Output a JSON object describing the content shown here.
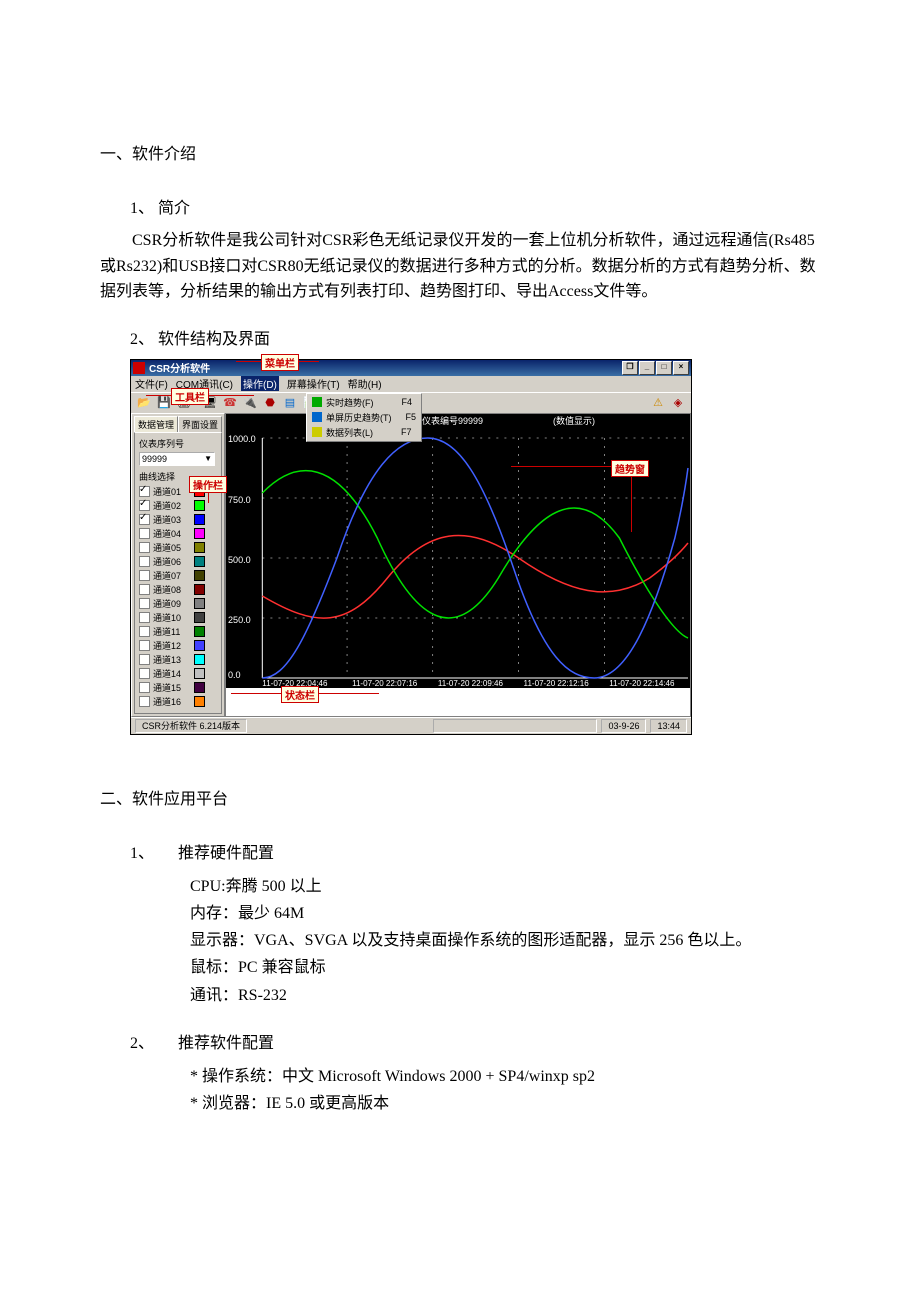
{
  "doc": {
    "s1_title": "一、软件介绍",
    "s1_1_title": "1、 简介",
    "s1_1_body": "        CSR分析软件是我公司针对CSR彩色无纸记录仪开发的一套上位机分析软件，通过远程通信(Rs485或Rs232)和USB接口对CSR80无纸记录仪的数据进行多种方式的分析。数据分析的方式有趋势分析、数据列表等，分析结果的输出方式有列表打印、趋势图打印、导出Access文件等。",
    "s1_2_title": "2、 软件结构及界面",
    "s2_title": "二、软件应用平台",
    "s2_1_title": "1、　　推荐硬件配置",
    "hw_cpu": "CPU:奔腾 500 以上",
    "hw_mem": "内存：最少 64M",
    "hw_disp": " 显示器：VGA、SVGA 以及支持桌面操作系统的图形适配器，显示 256 色以上。",
    "hw_mouse": " 鼠标：PC 兼容鼠标",
    "hw_comm": " 通讯：RS-232",
    "s2_2_title": "2、　　推荐软件配置",
    "sw_os": "*  操作系统：中文 Microsoft Windows 2000 + SP4/winxp sp2",
    "sw_ie": "*  浏览器：IE 5.0 或更高版本"
  },
  "app": {
    "title": "CSR分析软件",
    "win_restore": "❐",
    "win_min": "_",
    "win_max": "□",
    "win_close": "×",
    "menu": {
      "file": "文件(F)",
      "com": "COM通讯(C)",
      "op": "操作(D)",
      "screen": "屏幕操作(T)",
      "help": "帮助(H)"
    },
    "dropdown": {
      "r1": "实时趋势(F)",
      "r1k": "F4",
      "r2": "单屏历史趋势(T)",
      "r2k": "F5",
      "r3": "数据列表(L)",
      "r3k": "F7"
    },
    "sidebar": {
      "tab1": "数据管理",
      "tab2": "界面设置",
      "serial_label": "仪表序列号",
      "serial_value": "99999",
      "curve_label": "曲线选择"
    },
    "channels": [
      {
        "label": "通道01",
        "checked": true,
        "color": "#ff0000"
      },
      {
        "label": "通道02",
        "checked": true,
        "color": "#00ff00"
      },
      {
        "label": "通道03",
        "checked": true,
        "color": "#0000ff"
      },
      {
        "label": "通道04",
        "checked": false,
        "color": "#ff00ff"
      },
      {
        "label": "通道05",
        "checked": false,
        "color": "#808000"
      },
      {
        "label": "通道06",
        "checked": false,
        "color": "#008080"
      },
      {
        "label": "通道07",
        "checked": false,
        "color": "#404000"
      },
      {
        "label": "通道08",
        "checked": false,
        "color": "#800000"
      },
      {
        "label": "通道09",
        "checked": false,
        "color": "#808080"
      },
      {
        "label": "通道10",
        "checked": false,
        "color": "#404040"
      },
      {
        "label": "通道11",
        "checked": false,
        "color": "#008000"
      },
      {
        "label": "通道12",
        "checked": false,
        "color": "#4040ff"
      },
      {
        "label": "通道13",
        "checked": false,
        "color": "#00ffff"
      },
      {
        "label": "通道14",
        "checked": false,
        "color": "#c0c0c0"
      },
      {
        "label": "通道15",
        "checked": false,
        "color": "#400040"
      },
      {
        "label": "通道16",
        "checked": false,
        "color": "#ff8000"
      }
    ],
    "chart": {
      "header_id": "仪表编号99999",
      "header_mode": "(数值显示)",
      "y_ticks": [
        "1000.0",
        "750.0",
        "500.0",
        "250.0",
        "0.0"
      ],
      "x_ticks": [
        "11-07-20 22:04:46",
        "11-07-20 22:07:16",
        "11-07-20 22:09:46",
        "11-07-20 22:12:16",
        "11-07-20 22:14:46"
      ]
    },
    "status": {
      "left": "CSR分析软件  6.214版本",
      "date": "03-9-26",
      "time": "13:44"
    },
    "callouts": {
      "menubar": "菜单栏",
      "toolbar": "工具栏",
      "op_panel": "操作栏",
      "trend_win": "趋势窗",
      "statusbar": "状态栏"
    }
  },
  "chart_data": {
    "type": "line",
    "title": "仪表编号99999 (数值显示)",
    "xlabel": "",
    "ylabel": "",
    "ylim": [
      0,
      1000
    ],
    "x_categories": [
      "11-07-20 22:04:46",
      "11-07-20 22:07:16",
      "11-07-20 22:09:46",
      "11-07-20 22:12:16",
      "11-07-20 22:14:46"
    ],
    "series": [
      {
        "name": "通道01",
        "color": "#ff0000",
        "approx_amplitude": 150,
        "approx_center": 500,
        "approx_cycles_visible": 1.2,
        "note": "low-amplitude sinusoid"
      },
      {
        "name": "通道02",
        "color": "#00ff00",
        "approx_amplitude": 330,
        "approx_center": 500,
        "approx_cycles_visible": 1.8,
        "note": "medium-amplitude sinusoid"
      },
      {
        "name": "通道03",
        "color": "#0000ff",
        "approx_amplitude": 500,
        "approx_center": 500,
        "approx_cycles_visible": 1.8,
        "note": "full-scale sinusoid clipping at 0 and 1000"
      }
    ]
  }
}
